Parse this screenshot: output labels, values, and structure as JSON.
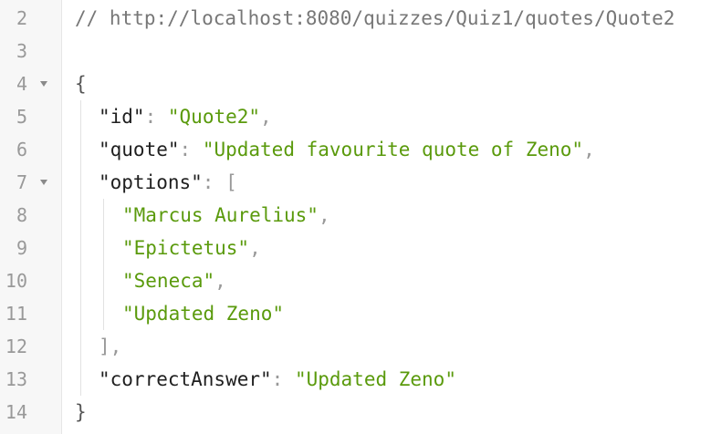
{
  "gutter": {
    "line_numbers": [
      "2",
      "3",
      "4",
      "5",
      "6",
      "7",
      "8",
      "9",
      "10",
      "11",
      "12",
      "13",
      "14"
    ],
    "fold_icon": "caret-down-icon"
  },
  "code": {
    "comment": "// http://localhost:8080/quizzes/Quiz1/quotes/Quote2",
    "open_brace": "{",
    "close_brace": "}",
    "id": {
      "key": "\"id\"",
      "value": "\"Quote2\""
    },
    "quote": {
      "key": "\"quote\"",
      "value": "\"Updated favourite quote of Zeno\""
    },
    "options": {
      "key": "\"options\"",
      "open": "[",
      "close": "],",
      "items": [
        "\"Marcus Aurelius\"",
        "\"Epictetus\"",
        "\"Seneca\"",
        "\"Updated Zeno\""
      ]
    },
    "correctAnswer": {
      "key": "\"correctAnswer\"",
      "value": "\"Updated Zeno\""
    },
    "colon": ":",
    "comma": ","
  },
  "colors": {
    "string": "#5a9a0c",
    "key": "#1f1f1f",
    "punctuation": "#999999",
    "comment": "#777777",
    "gutter_background": "#f7f7f7"
  }
}
